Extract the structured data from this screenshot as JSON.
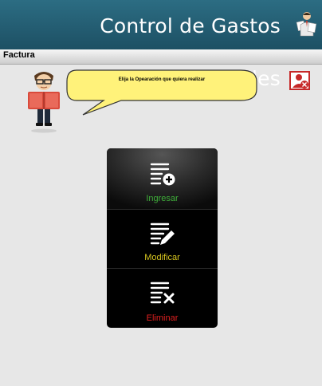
{
  "header": {
    "title": "Control de Gastos Personales",
    "icon": "user-with-documents-icon"
  },
  "section": {
    "label": "Factura"
  },
  "assistant": {
    "message": "Elija la Opearación que quiera realizar",
    "mascot": "reading-man-icon"
  },
  "toolbar": {
    "exit_icon": "user-remove-icon"
  },
  "menu": {
    "items": [
      {
        "label": "Ingresar",
        "icon": "add-record-icon",
        "color": "#3fae3a"
      },
      {
        "label": "Modificar",
        "icon": "edit-record-icon",
        "color": "#d6c51f"
      },
      {
        "label": "Eliminar",
        "icon": "delete-record-icon",
        "color": "#e02020"
      }
    ]
  }
}
